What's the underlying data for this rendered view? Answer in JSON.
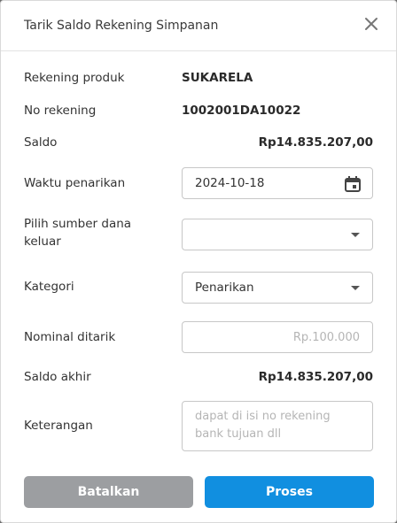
{
  "modal": {
    "title": "Tarik Saldo Rekening Simpanan"
  },
  "fields": {
    "product_label": "Rekening produk",
    "product_value": "SUKARELA",
    "account_label": "No rekening",
    "account_value": "1002001DA10022",
    "balance_label": "Saldo",
    "balance_value": "Rp14.835.207,00",
    "date_label": "Waktu penarikan",
    "date_value": "2024-10-18",
    "source_label_line1": "Pilih sumber dana",
    "source_label_line2": "keluar",
    "source_value": "",
    "category_label": "Kategori",
    "category_value": "Penarikan",
    "amount_label": "Nominal ditarik",
    "amount_placeholder": "Rp.100.000",
    "final_balance_label": "Saldo akhir",
    "final_balance_value": "Rp14.835.207,00",
    "note_label": "Keterangan",
    "note_placeholder": "dapat di isi no rekening bank tujuan dll"
  },
  "buttons": {
    "cancel_label": "Batalkan",
    "submit_label": "Proses"
  },
  "icons": {
    "close": "close-icon",
    "calendar": "calendar-icon",
    "dropdown": "chevron-down-icon"
  },
  "colors": {
    "primary": "#118fe0",
    "cancel": "#9c9ea1"
  }
}
